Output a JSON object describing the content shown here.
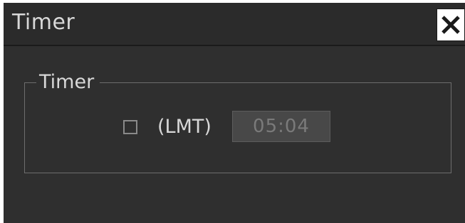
{
  "window": {
    "title": "Timer",
    "close_icon": "close-icon"
  },
  "group": {
    "legend": "Timer",
    "checkbox_checked": false,
    "time_label": "(LMT)",
    "time_value": "05:04"
  },
  "colors": {
    "background": "#2f2f2f",
    "titlebar": "#2b2b2b",
    "text": "#d8d8d8",
    "field_bg": "#484848",
    "field_text": "#7a7a7a"
  }
}
